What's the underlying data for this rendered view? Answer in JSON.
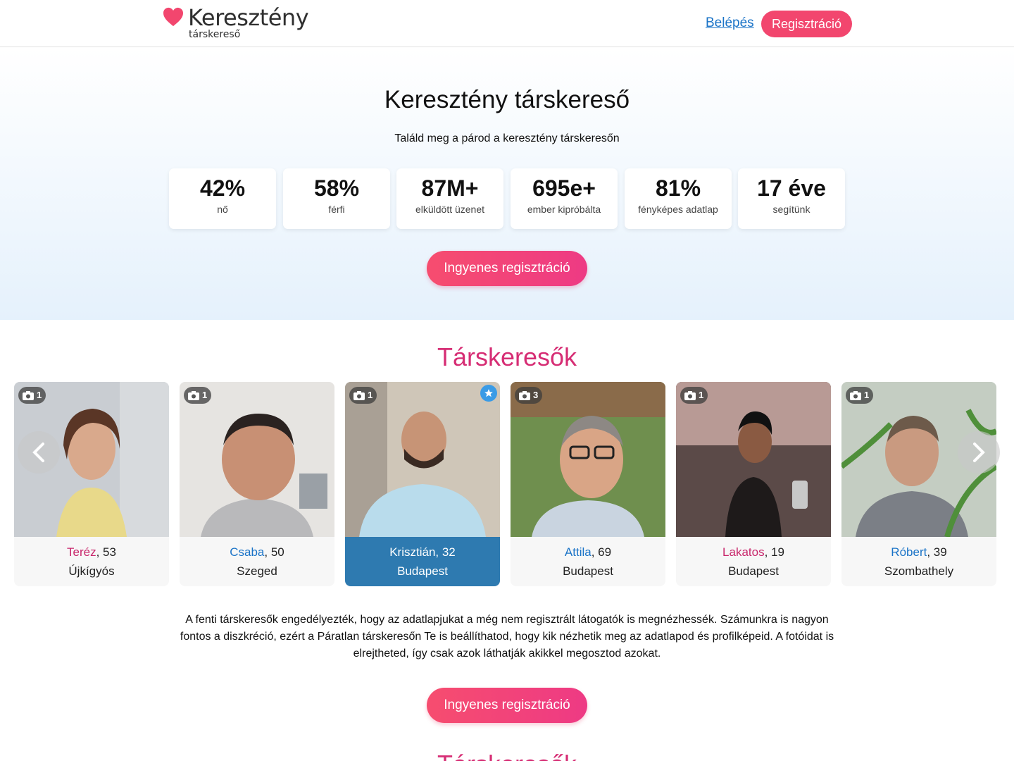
{
  "header": {
    "brand_main": "Keresztény",
    "brand_sub": "társkereső",
    "login": "Belépés",
    "register": "Regisztráció",
    "brand_color": "#f2466e"
  },
  "hero": {
    "title": "Keresztény társkereső",
    "subtitle": "Találd meg a párod a keresztény társkeresőn",
    "stats": [
      {
        "value": "42%",
        "label": "nő"
      },
      {
        "value": "58%",
        "label": "férfi"
      },
      {
        "value": "87M+",
        "label": "elküldött üzenet"
      },
      {
        "value": "695e+",
        "label": "ember kipróbálta"
      },
      {
        "value": "81%",
        "label": "fényképes adatlap"
      },
      {
        "value": "17 éve",
        "label": "segítünk"
      }
    ],
    "cta": "Ingyenes regisztráció"
  },
  "section": {
    "title": "Társkeresők",
    "profiles": [
      {
        "name": "Teréz",
        "age": ", 53",
        "city": "Újkígyós",
        "photos": "1",
        "gender": "f"
      },
      {
        "name": "Csaba",
        "age": ", 50",
        "city": "Szeged",
        "photos": "1",
        "gender": "m"
      },
      {
        "name": "Krisztián",
        "age": ", 32",
        "city": "Budapest",
        "photos": "1",
        "gender": "m",
        "featured": true
      },
      {
        "name": "Attila",
        "age": ", 69",
        "city": "Budapest",
        "photos": "3",
        "gender": "m"
      },
      {
        "name": "Lakatos",
        "age": ", 19",
        "city": "Budapest",
        "photos": "1",
        "gender": "f"
      },
      {
        "name": "Róbert",
        "age": ", 39",
        "city": "Szombathely",
        "photos": "1",
        "gender": "m"
      }
    ],
    "description": "A fenti társkeresők engedélyezték, hogy az adatlapjukat a még nem regisztrált látogatók is megnézhessék. Számunkra is nagyon fontos a diszkréció, ezért a Páratlan társkeresőn Te is beállíthatod, hogy kik nézhetik meg az adatlapod és profilképeid. A fotóidat is elrejtheted, így csak azok láthatják akikkel megosztod azokat.",
    "cta": "Ingyenes regisztráció",
    "next_title": "Társkeresők"
  }
}
